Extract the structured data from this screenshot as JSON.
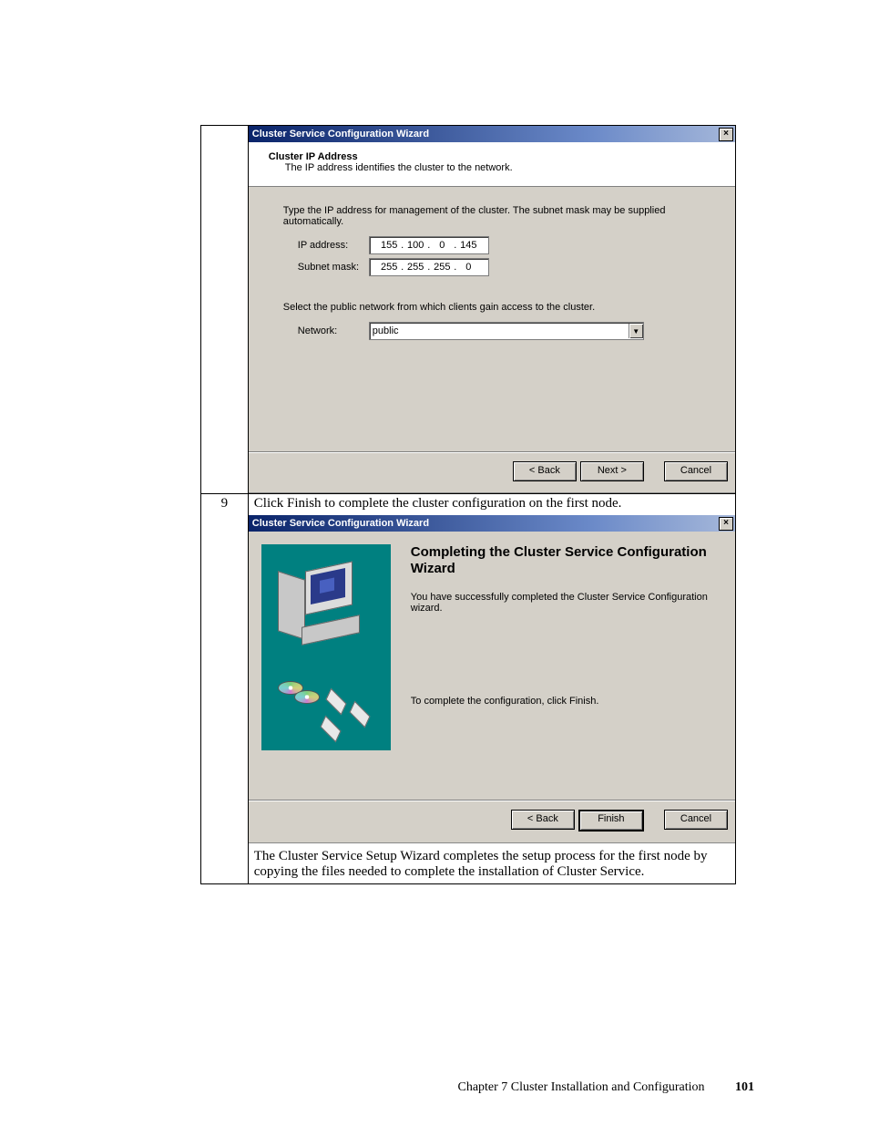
{
  "step": "9",
  "dlg1": {
    "title": "Cluster Service Configuration Wizard",
    "heading": "Cluster IP Address",
    "subheading": "The IP address identifies the cluster to the network.",
    "instruction": "Type the IP address for management of the cluster. The subnet mask may be supplied automatically.",
    "ip_label": "IP address:",
    "ip_value": [
      "155",
      "100",
      "0",
      "145"
    ],
    "subnet_label": "Subnet mask:",
    "subnet_value": [
      "255",
      "255",
      "255",
      "0"
    ],
    "network_instruction": "Select the public network from which clients gain access to the cluster.",
    "network_label": "Network:",
    "network_value": "public",
    "buttons": {
      "back": "< Back",
      "next": "Next >",
      "cancel": "Cancel"
    }
  },
  "intro_text": "Click Finish to complete the cluster configuration on the first node.",
  "dlg2": {
    "title": "Cluster Service Configuration Wizard",
    "heading": "Completing the Cluster Service Configuration Wizard",
    "para1": "You have successfully completed the Cluster Service Configuration wizard.",
    "para2": "To complete the configuration, click Finish.",
    "buttons": {
      "back": "< Back",
      "finish": "Finish",
      "cancel": "Cancel"
    }
  },
  "outro_text": "The Cluster Service Setup Wizard completes the setup process for the first node by copying the files needed to complete the installation of Cluster Service.",
  "footer": {
    "chapter": "Chapter 7 Cluster Installation and Configuration",
    "page": "101"
  }
}
